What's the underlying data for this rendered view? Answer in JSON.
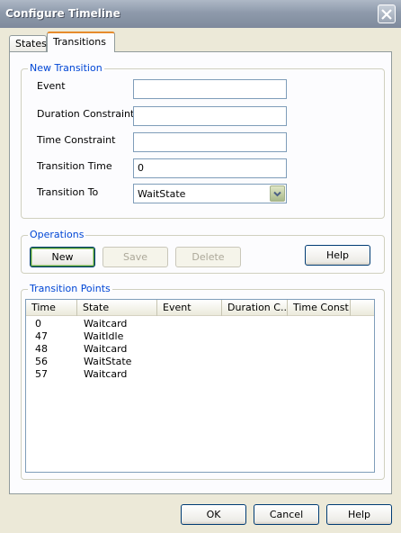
{
  "window": {
    "title": "Configure Timeline"
  },
  "tabs": [
    {
      "label": "States"
    },
    {
      "label": "Transitions"
    }
  ],
  "new_transition": {
    "group_label": "New Transition",
    "event_label": "Event",
    "event_value": "",
    "duration_label": "Duration Constraint",
    "duration_value": "",
    "time_constraint_label": "Time Constraint",
    "time_constraint_value": "",
    "transition_time_label": "Transition Time",
    "transition_time_value": "0",
    "transition_to_label": "Transition To",
    "transition_to_value": "WaitState"
  },
  "operations": {
    "group_label": "Operations",
    "new_label": "New",
    "save_label": "Save",
    "delete_label": "Delete",
    "help_label": "Help"
  },
  "transition_points": {
    "group_label": "Transition Points",
    "columns": [
      "Time",
      "State",
      "Event",
      "Duration C...",
      "Time Const..."
    ],
    "rows": [
      {
        "time": "0",
        "state": "Waitcard"
      },
      {
        "time": "47",
        "state": "WaitIdle"
      },
      {
        "time": "48",
        "state": "Waitcard"
      },
      {
        "time": "56",
        "state": "WaitState"
      },
      {
        "time": "57",
        "state": "Waitcard"
      }
    ]
  },
  "footer": {
    "ok_label": "OK",
    "cancel_label": "Cancel",
    "help_label": "Help"
  }
}
